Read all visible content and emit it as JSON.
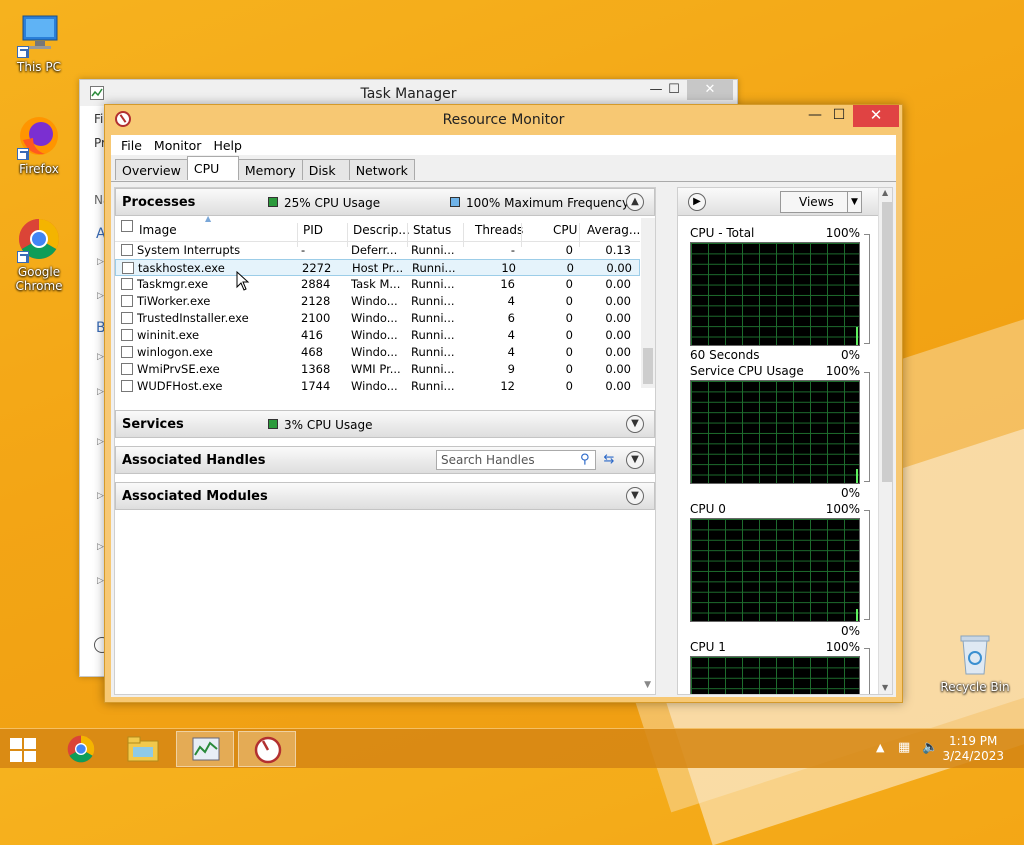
{
  "desktop": {
    "icons": [
      {
        "label": "This PC"
      },
      {
        "label": "Firefox"
      },
      {
        "label": "Google Chrome"
      },
      {
        "label": "Recycle Bin"
      }
    ]
  },
  "task_manager": {
    "title": "Task Manager",
    "menu_fragment": "Fil",
    "tab_fragment": "Pr",
    "left_letters": [
      "Na",
      "A",
      "B"
    ],
    "controls": [
      "—",
      "☐",
      "✕"
    ]
  },
  "resource_monitor": {
    "title": "Resource Monitor",
    "controls": [
      "—",
      "☐",
      "✕"
    ],
    "menu": [
      "File",
      "Monitor",
      "Help"
    ],
    "tabs": [
      "Overview",
      "CPU",
      "Memory",
      "Disk",
      "Network"
    ],
    "active_tab": "CPU",
    "processes": {
      "title": "Processes",
      "cpu_usage": "25% CPU Usage",
      "max_freq": "100% Maximum Frequency",
      "columns": [
        "Image",
        "PID",
        "Descrip...",
        "Status",
        "Threads",
        "CPU",
        "Averag..."
      ],
      "rows": [
        {
          "image": "System Interrupts",
          "pid": "-",
          "desc": "Deferr...",
          "status": "Runni...",
          "threads": "-",
          "cpu": "0",
          "avg": "0.13"
        },
        {
          "image": "taskhostex.exe",
          "pid": "2272",
          "desc": "Host Pr...",
          "status": "Runni...",
          "threads": "10",
          "cpu": "0",
          "avg": "0.00"
        },
        {
          "image": "Taskmgr.exe",
          "pid": "2884",
          "desc": "Task M...",
          "status": "Runni...",
          "threads": "16",
          "cpu": "0",
          "avg": "0.00"
        },
        {
          "image": "TiWorker.exe",
          "pid": "2128",
          "desc": "Windo...",
          "status": "Runni...",
          "threads": "4",
          "cpu": "0",
          "avg": "0.00"
        },
        {
          "image": "TrustedInstaller.exe",
          "pid": "2100",
          "desc": "Windo...",
          "status": "Runni...",
          "threads": "6",
          "cpu": "0",
          "avg": "0.00"
        },
        {
          "image": "wininit.exe",
          "pid": "416",
          "desc": "Windo...",
          "status": "Runni...",
          "threads": "4",
          "cpu": "0",
          "avg": "0.00"
        },
        {
          "image": "winlogon.exe",
          "pid": "468",
          "desc": "Windo...",
          "status": "Runni...",
          "threads": "4",
          "cpu": "0",
          "avg": "0.00"
        },
        {
          "image": "WmiPrvSE.exe",
          "pid": "1368",
          "desc": "WMI Pr...",
          "status": "Runni...",
          "threads": "9",
          "cpu": "0",
          "avg": "0.00"
        },
        {
          "image": "WUDFHost.exe",
          "pid": "1744",
          "desc": "Windo...",
          "status": "Runni...",
          "threads": "12",
          "cpu": "0",
          "avg": "0.00"
        }
      ]
    },
    "services": {
      "title": "Services",
      "cpu_usage": "3% CPU Usage"
    },
    "handles": {
      "title": "Associated Handles",
      "search_placeholder": "Search Handles"
    },
    "modules": {
      "title": "Associated Modules"
    },
    "graphs": {
      "views_label": "Views",
      "items": [
        {
          "name": "CPU - Total",
          "max": "100%",
          "footer_left": "60 Seconds",
          "footer_right": "0%"
        },
        {
          "name": "Service CPU Usage",
          "max": "100%",
          "footer_left": "",
          "footer_right": "0%"
        },
        {
          "name": "CPU 0",
          "max": "100%",
          "footer_left": "",
          "footer_right": "0%"
        },
        {
          "name": "CPU 1",
          "max": "100%",
          "footer_left": "",
          "footer_right": ""
        }
      ]
    }
  },
  "taskbar": {
    "time": "1:19 PM",
    "date": "3/24/2023"
  },
  "colors": {
    "wallpaper": "#f3a515",
    "graph_bg": "#000000",
    "graph_grid": "#1d6b2d",
    "close_red": "#e04343",
    "cpu_usage_swatch": "#2c9a3c",
    "freq_swatch": "#6fb3e8"
  }
}
